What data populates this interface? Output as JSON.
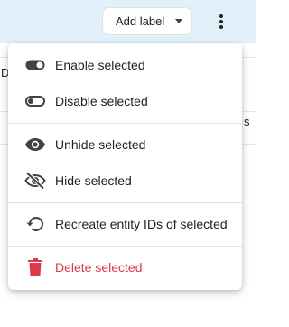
{
  "toolbar": {
    "add_label": "Add label"
  },
  "background": {
    "left_fragment": "D",
    "right_fragment": "s"
  },
  "menu": {
    "items": [
      {
        "label": "Enable selected",
        "icon": "toggle-on-icon"
      },
      {
        "label": "Disable selected",
        "icon": "toggle-off-icon"
      },
      {
        "label": "Unhide selected",
        "icon": "eye-icon"
      },
      {
        "label": "Hide selected",
        "icon": "eye-off-icon"
      },
      {
        "label": "Recreate entity IDs of selected",
        "icon": "restore-icon"
      },
      {
        "label": "Delete selected",
        "icon": "trash-icon"
      }
    ]
  },
  "colors": {
    "topbar_bg": "#e1f1f9",
    "danger": "#db3a4b",
    "icon": "#424242"
  }
}
